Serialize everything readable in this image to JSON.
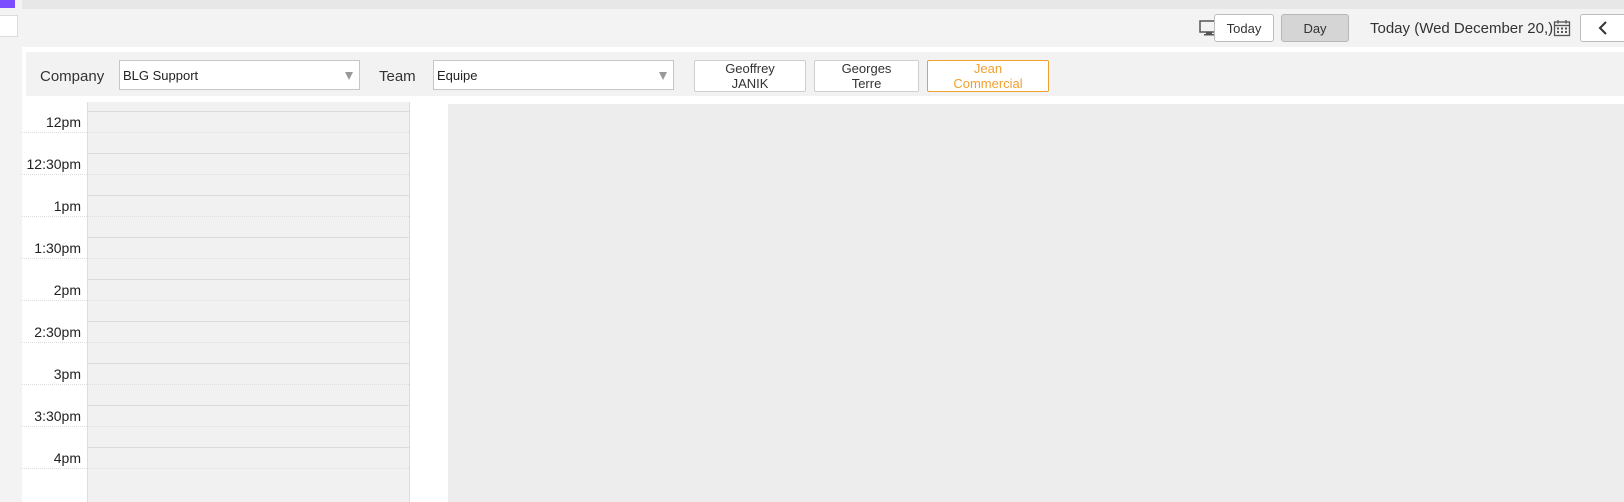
{
  "toolbar": {
    "today_label": "Today",
    "day_label": "Day",
    "date_label": "Today (Wed December 20,)",
    "icons": {
      "display": "monitor-icon",
      "calendar": "calendar-icon",
      "prev": "chevron-left-icon"
    }
  },
  "filters": {
    "company_label": "Company",
    "company_value": "BLG Support",
    "team_label": "Team",
    "team_value": "Equipe",
    "users": [
      {
        "name": "Geoffrey JANIK",
        "selected": false
      },
      {
        "name": "Georges Terre",
        "selected": false
      },
      {
        "name": "Jean Commercial",
        "selected": true
      }
    ]
  },
  "calendar": {
    "time_slots": [
      "12pm",
      "12:30pm",
      "1pm",
      "1:30pm",
      "2pm",
      "2:30pm",
      "3pm",
      "3:30pm",
      "4pm"
    ]
  },
  "colors": {
    "accent_purple": "#7c4dff",
    "selected_user": "#f0a030",
    "active_view_bg": "#d5d5d5"
  }
}
